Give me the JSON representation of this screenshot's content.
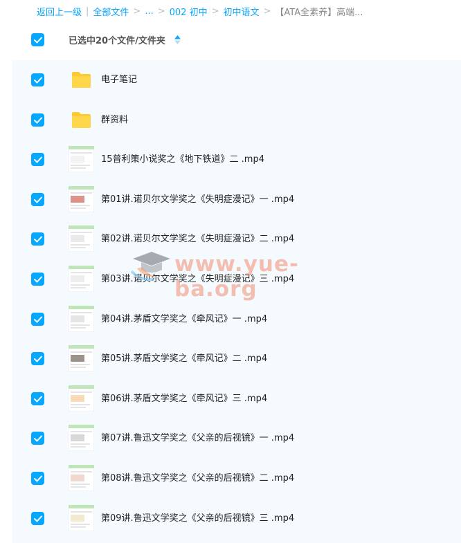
{
  "breadcrumb": {
    "back": "返回上一级",
    "all_files": "全部文件",
    "ellipsis": "...",
    "folder1": "002 初中",
    "folder2": "初中语文",
    "current": "【ATA全素养】高端..."
  },
  "header": {
    "selection_label": "已选中20个文件/文件夹"
  },
  "files": [
    {
      "name": "电子笔记",
      "type": "folder"
    },
    {
      "name": "群资料",
      "type": "folder"
    },
    {
      "name": "15普利策小说奖之《地下铁道》二 .mp4",
      "type": "video"
    },
    {
      "name": "第01讲.诺贝尔文学奖之《失明症漫记》一 .mp4",
      "type": "video"
    },
    {
      "name": "第02讲.诺贝尔文学奖之《失明症漫记》二 .mp4",
      "type": "video"
    },
    {
      "name": "第03讲.诺贝尔文学奖之《失明症漫记》三 .mp4",
      "type": "video"
    },
    {
      "name": "第04讲.茅盾文学奖之《牵风记》一 .mp4",
      "type": "video"
    },
    {
      "name": "第05讲.茅盾文学奖之《牵风记》二 .mp4",
      "type": "video"
    },
    {
      "name": "第06讲.茅盾文学奖之《牵风记》三 .mp4",
      "type": "video"
    },
    {
      "name": "第07讲.鲁迅文学奖之《父亲的后视镜》一 .mp4",
      "type": "video"
    },
    {
      "name": "第08讲.鲁迅文学奖之《父亲的后视镜》二 .mp4",
      "type": "video"
    },
    {
      "name": "第09讲.鲁迅文学奖之《父亲的后视镜》三 .mp4",
      "type": "video"
    }
  ],
  "watermark": {
    "text": "www.yue-ba.org"
  },
  "colors": {
    "accent": "#06a7ff",
    "folder": "#ffc933",
    "list_bg": "#f5fafe"
  }
}
